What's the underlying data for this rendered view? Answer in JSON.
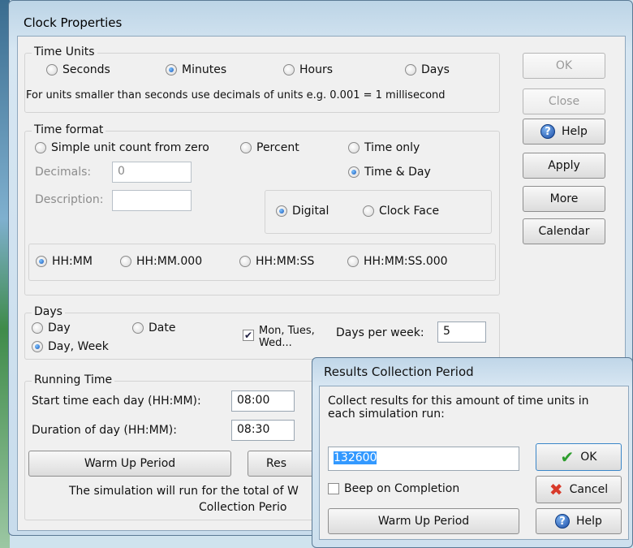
{
  "main_window": {
    "title": "Clock Properties",
    "time_units": {
      "group_title": "Time Units",
      "options": [
        "Seconds",
        "Minutes",
        "Hours",
        "Days"
      ],
      "selected": "Minutes",
      "note": "For units smaller than seconds use decimals of units e.g. 0.001 = 1 millisecond"
    },
    "time_format": {
      "group_title": "Time format",
      "simple_unit": "Simple unit count from zero",
      "percent": "Percent",
      "time_only": "Time only",
      "time_and_day": "Time & Day",
      "decimals_label": "Decimals:",
      "decimals_value": "0",
      "description_label": "Description:",
      "description_value": "",
      "digital": "Digital",
      "clock_face": "Clock Face",
      "hhmm": "HH:MM",
      "hhmm000": "HH:MM.000",
      "hhmmss": "HH:MM:SS",
      "hhmmss000": "HH:MM:SS.000"
    },
    "days": {
      "group_title": "Days",
      "day": "Day",
      "date": "Date",
      "day_week": "Day, Week",
      "mon_tues": "Mon, Tues, Wed...",
      "mon_tues_checked": true,
      "days_per_week_label": "Days per week:",
      "days_per_week_value": "5"
    },
    "running_time": {
      "group_title": "Running Time",
      "start_label": "Start time each day (HH:MM):",
      "start_value": "08:00",
      "duration_label": "Duration of day (HH:MM):",
      "duration_value": "08:30",
      "warm_up_button": "Warm Up Period",
      "results_button_partial": "Res",
      "summary_line1": "The simulation will run for the total of W",
      "summary_line2": "Collection Perio"
    },
    "buttons": {
      "ok": "OK",
      "close": "Close",
      "help": "Help",
      "apply": "Apply",
      "more": "More",
      "calendar": "Calendar"
    }
  },
  "dialog": {
    "title": "Results Collection Period",
    "prompt": "Collect results for this amount of time units in each simulation run:",
    "value": "132600",
    "beep_label": "Beep on Completion",
    "beep_checked": false,
    "ok": "OK",
    "cancel": "Cancel",
    "warm_up": "Warm Up Period",
    "help": "Help"
  },
  "colors": {
    "ok_check": "#2e9e2e",
    "cancel_x": "#d83a2a",
    "selection": "#3399ff"
  }
}
